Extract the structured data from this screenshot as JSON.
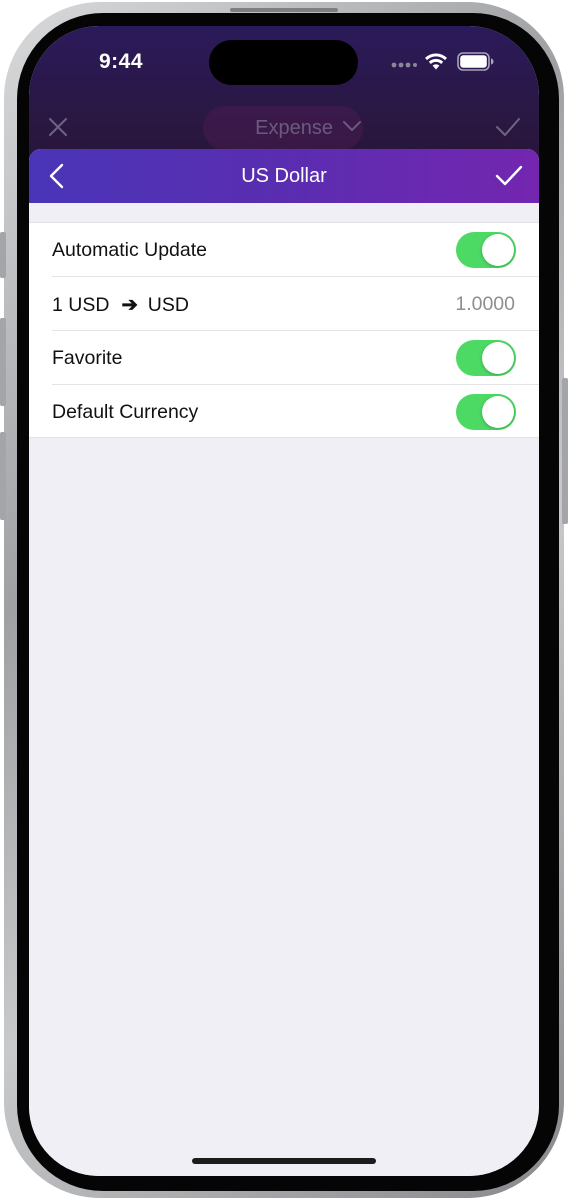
{
  "status_bar": {
    "time": "9:44"
  },
  "background_sheet": {
    "title": "Expense",
    "close_icon": "close-icon",
    "chevron_icon": "chevron-down-icon",
    "confirm_icon": "checkmark-icon"
  },
  "nav": {
    "title": "US Dollar",
    "back_icon": "chevron-left-icon",
    "confirm_icon": "checkmark-icon"
  },
  "settings": {
    "rows": [
      {
        "label": "Automatic Update",
        "type": "toggle",
        "on": true
      },
      {
        "from_label": "1 USD",
        "arrow": "➔",
        "to_label": "USD",
        "value": "1.0000",
        "type": "value"
      },
      {
        "label": "Favorite",
        "type": "toggle",
        "on": true
      },
      {
        "label": "Default Currency",
        "type": "toggle",
        "on": true
      }
    ]
  },
  "colors": {
    "accent_gradient_start": "#4a35b8",
    "accent_gradient_end": "#7426b0",
    "toggle_on": "#4cd964",
    "background": "#f0eff5"
  }
}
